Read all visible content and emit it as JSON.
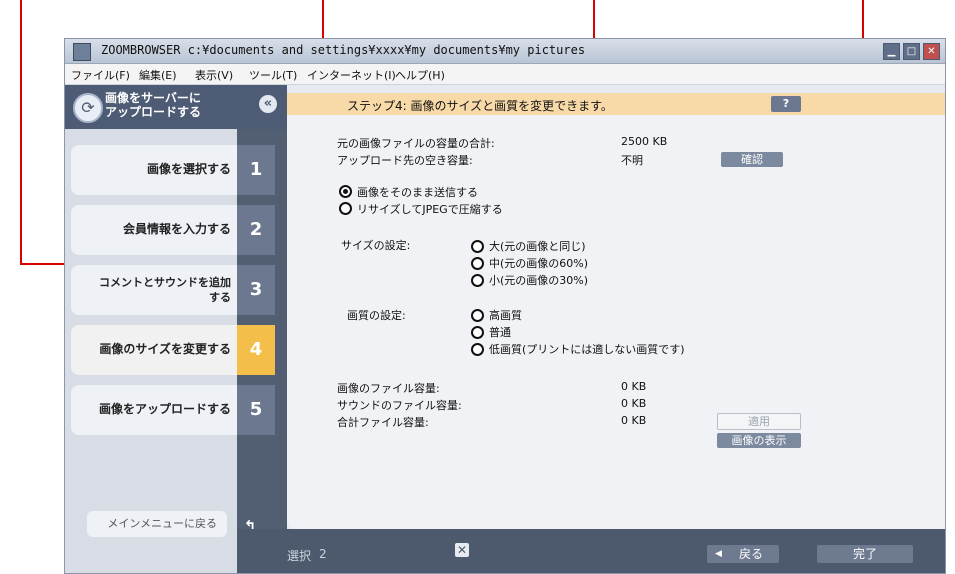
{
  "window": {
    "title": "ZOOMBROWSER c:¥documents and settings¥xxxx¥my documents¥my pictures",
    "controls": {
      "minimize": "▁",
      "maximize": "□",
      "close": "✕"
    }
  },
  "menubar": {
    "items": [
      "ファイル(F)",
      "編集(E)",
      "表示(V)",
      "ツール(T)",
      "インターネット(I)",
      "ヘルプ(H)"
    ]
  },
  "sidebar": {
    "title_line1": "画像をサーバーに",
    "title_line2": "アップロードする",
    "collapse": "«",
    "steps": [
      {
        "label": "画像を選択する",
        "num": "1"
      },
      {
        "label": "会員情報を入力する",
        "num": "2"
      },
      {
        "label_line1": "コメントとサウンドを追加",
        "label_line2": "する",
        "num": "3"
      },
      {
        "label": "画像のサイズを変更する",
        "num": "4"
      },
      {
        "label": "画像をアップロードする",
        "num": "5"
      }
    ],
    "active_step": 4,
    "back_main": "メインメニューに戻る",
    "back_main_icon": "↰"
  },
  "header": {
    "title": "ステップ4: 画像のサイズと画質を変更できます。",
    "help": "?"
  },
  "capacity": {
    "original_total_label": "元の画像ファイルの容量の合計:",
    "original_total_value": "2500 KB",
    "free_space_label": "アップロード先の空き容量:",
    "free_space_value": "不明",
    "confirm_button": "確認"
  },
  "send_mode": {
    "options": [
      "画像をそのまま送信する",
      "リサイズしてJPEGで圧縮する"
    ],
    "selected": 0
  },
  "size_setting": {
    "label": "サイズの設定:",
    "options": [
      "大(元の画像と同じ)",
      "中(元の画像の60%)",
      "小(元の画像の30%)"
    ]
  },
  "quality_setting": {
    "label": "画質の設定:",
    "options": [
      "高画質",
      "普通",
      "低画質(プリントには適しない画質です)"
    ]
  },
  "summary": {
    "image_size_label": "画像のファイル容量:",
    "image_size_value": "0 KB",
    "sound_size_label": "サウンドのファイル容量:",
    "sound_size_value": "0 KB",
    "total_size_label": "合計ファイル容量:",
    "total_size_value": "0 KB",
    "apply_button": "適用",
    "show_image_button": "画像の表示"
  },
  "footer": {
    "selection_label": "選択",
    "selection_count": "2",
    "clear_icon": "✕",
    "back_button": "戻る",
    "back_arrow": "◀",
    "finish_button": "完了"
  },
  "colors": {
    "annotation": "#d90000",
    "active_step": "#f3be4a",
    "header_band": "#f8d9a8"
  }
}
